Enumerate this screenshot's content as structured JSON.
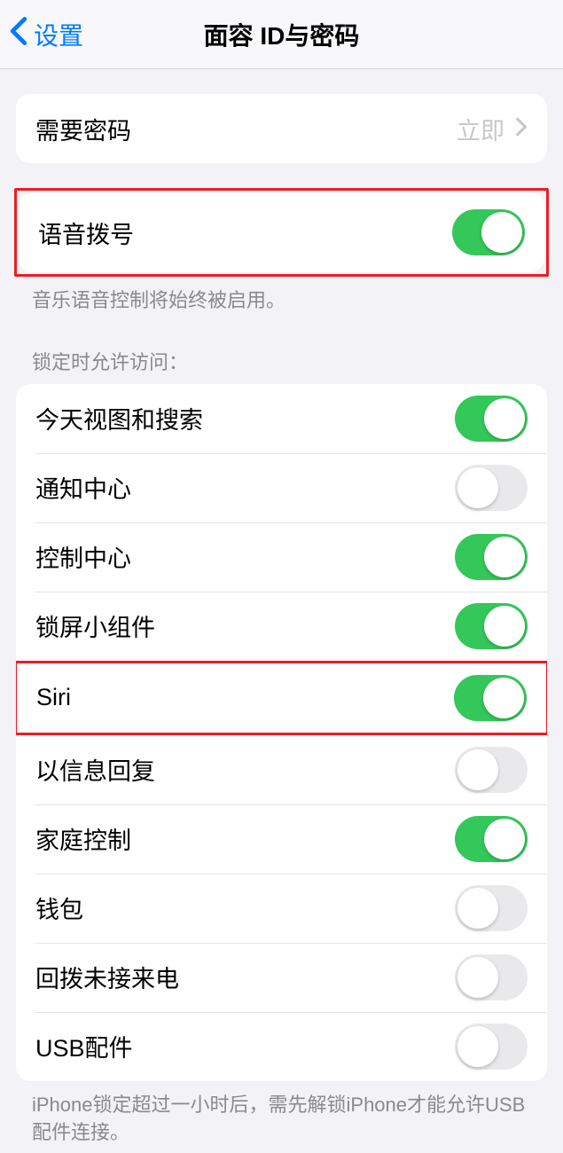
{
  "nav": {
    "back_label": "设置",
    "title": "面容 ID与密码"
  },
  "require_passcode": {
    "label": "需要密码",
    "value": "立即"
  },
  "voice_dial": {
    "label": "语音拨号",
    "on": true,
    "footer": "音乐语音控制将始终被启用。"
  },
  "lock_section_header": "锁定时允许访问：",
  "lock_items": [
    {
      "label": "今天视图和搜索",
      "on": true
    },
    {
      "label": "通知中心",
      "on": false
    },
    {
      "label": "控制中心",
      "on": true
    },
    {
      "label": "锁屏小组件",
      "on": true
    },
    {
      "label": "Siri",
      "on": true
    },
    {
      "label": "以信息回复",
      "on": false
    },
    {
      "label": "家庭控制",
      "on": true
    },
    {
      "label": "钱包",
      "on": false
    },
    {
      "label": "回拨未接来电",
      "on": false
    },
    {
      "label": "USB配件",
      "on": false
    }
  ],
  "lock_footer": "iPhone锁定超过一小时后，需先解锁iPhone才能允许USB配件连接。"
}
